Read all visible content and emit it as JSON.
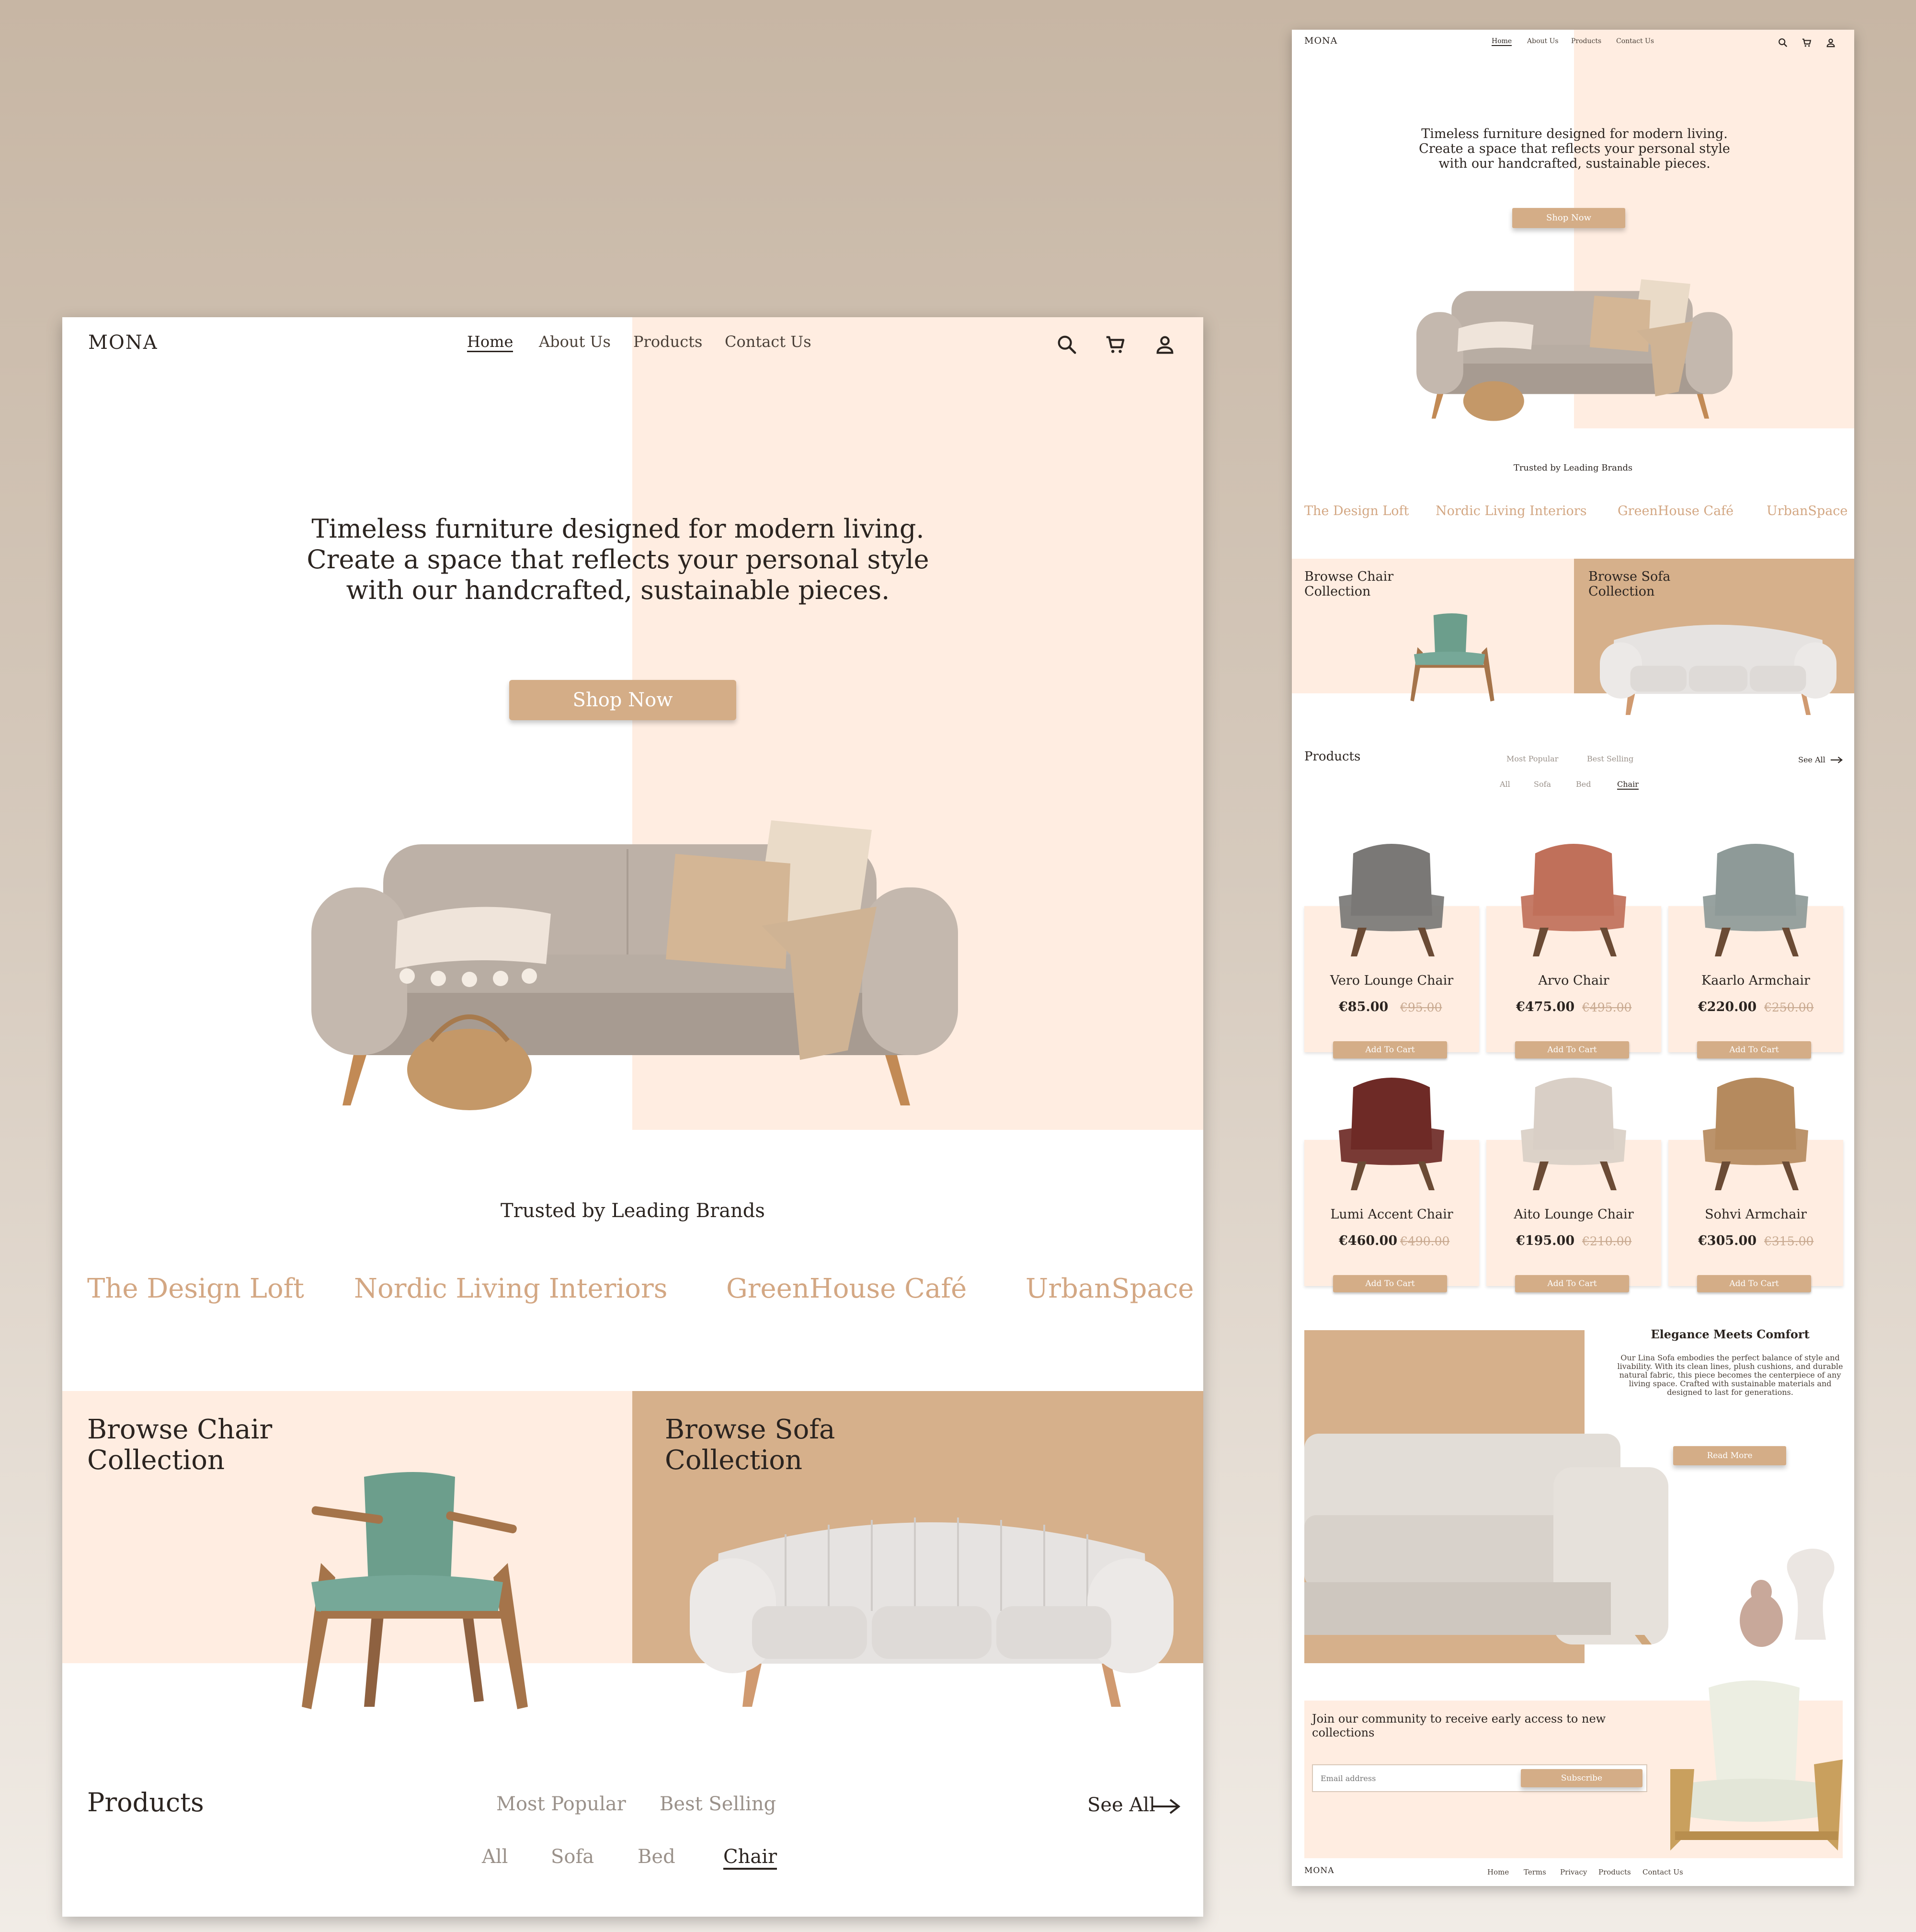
{
  "desktop": {
    "logo": "MONA",
    "nav": {
      "home": "Home",
      "about": "About Us",
      "products": "Products",
      "contact": "Contact Us"
    },
    "icons": [
      "search-icon",
      "cart-icon",
      "user-icon"
    ],
    "hero": {
      "line1": "Timeless furniture designed for modern living.",
      "line2": "Create a space that reflects your personal style",
      "line3": "with our handcrafted, sustainable pieces.",
      "cta": "Shop Now"
    },
    "trusted_title": "Trusted by Leading Brands",
    "brands": [
      "The Design Loft",
      "Nordic Living Interiors",
      "GreenHouse Café",
      "UrbanSpace"
    ],
    "collections": {
      "chair_line1": "Browse Chair",
      "chair_line2": "Collection",
      "sofa_line1": "Browse Sofa",
      "sofa_line2": "Collection"
    },
    "products": {
      "title": "Products",
      "sort_tabs": [
        "Most Popular",
        "Best Selling"
      ],
      "see_all": "See All",
      "category_tabs": [
        "All",
        "Sofa",
        "Bed",
        "Chair"
      ],
      "selected_category": "Chair"
    }
  },
  "mobile": {
    "logo": "MONA",
    "nav": {
      "home": "Home",
      "about": "About Us",
      "products": "Products",
      "contact": "Contact Us"
    },
    "hero": {
      "line1": "Timeless furniture designed for modern living.",
      "line2": "Create a space that reflects your personal style",
      "line3": "with our handcrafted, sustainable pieces.",
      "cta": "Shop Now"
    },
    "trusted_title": "Trusted by Leading Brands",
    "brands": [
      "The Design Loft",
      "Nordic Living Interiors",
      "GreenHouse Café",
      "UrbanSpace"
    ],
    "collections": {
      "chair_line1": "Browse Chair",
      "chair_line2": "Collection",
      "sofa_line1": "Browse Sofa",
      "sofa_line2": "Collection"
    },
    "products": {
      "title": "Products",
      "sort_tabs": [
        "Most Popular",
        "Best Selling"
      ],
      "see_all": "See All",
      "category_tabs": [
        "All",
        "Sofa",
        "Bed",
        "Chair"
      ],
      "add_to_cart": "Add To Cart",
      "items": [
        {
          "name": "Vero Lounge Chair",
          "price": "€85.00",
          "old_price": "€95.00",
          "color": "#7a7876"
        },
        {
          "name": "Arvo Chair",
          "price": "€475.00",
          "old_price": "€495.00",
          "color": "#c0705a"
        },
        {
          "name": "Kaarlo Armchair",
          "price": "€220.00",
          "old_price": "€250.00",
          "color": "#8e9a98"
        },
        {
          "name": "Lumi Accent Chair",
          "price": "€460.00",
          "old_price": "€490.00",
          "color": "#6e2a26"
        },
        {
          "name": "Aito Lounge Chair",
          "price": "€195.00",
          "old_price": "€210.00",
          "color": "#d9cfc6"
        },
        {
          "name": "Sohvi Armchair",
          "price": "€305.00",
          "old_price": "€315.00",
          "color": "#b58a5e"
        }
      ]
    },
    "feature": {
      "title": "Elegance Meets Comfort",
      "body": "Our Lina Sofa embodies the perfect balance of style and livability. With its clean lines, plush cushions, and durable natural fabric, this piece becomes the centerpiece of any living space. Crafted with sustainable materials and designed to last for generations.",
      "cta": "Read More"
    },
    "newsletter": {
      "title": "Join our community to receive early access to new collections",
      "placeholder": "Email address",
      "cta": "Subscribe"
    },
    "footer": {
      "logo": "MONA",
      "links": [
        "Home",
        "Terms",
        "Privacy",
        "Products",
        "Contact Us"
      ]
    }
  },
  "colors": {
    "accent": "#d4ad87",
    "peach": "#ffede1",
    "tan": "#d6b08b",
    "brand_text": "#d3a783",
    "background": "#c7b6a4"
  }
}
